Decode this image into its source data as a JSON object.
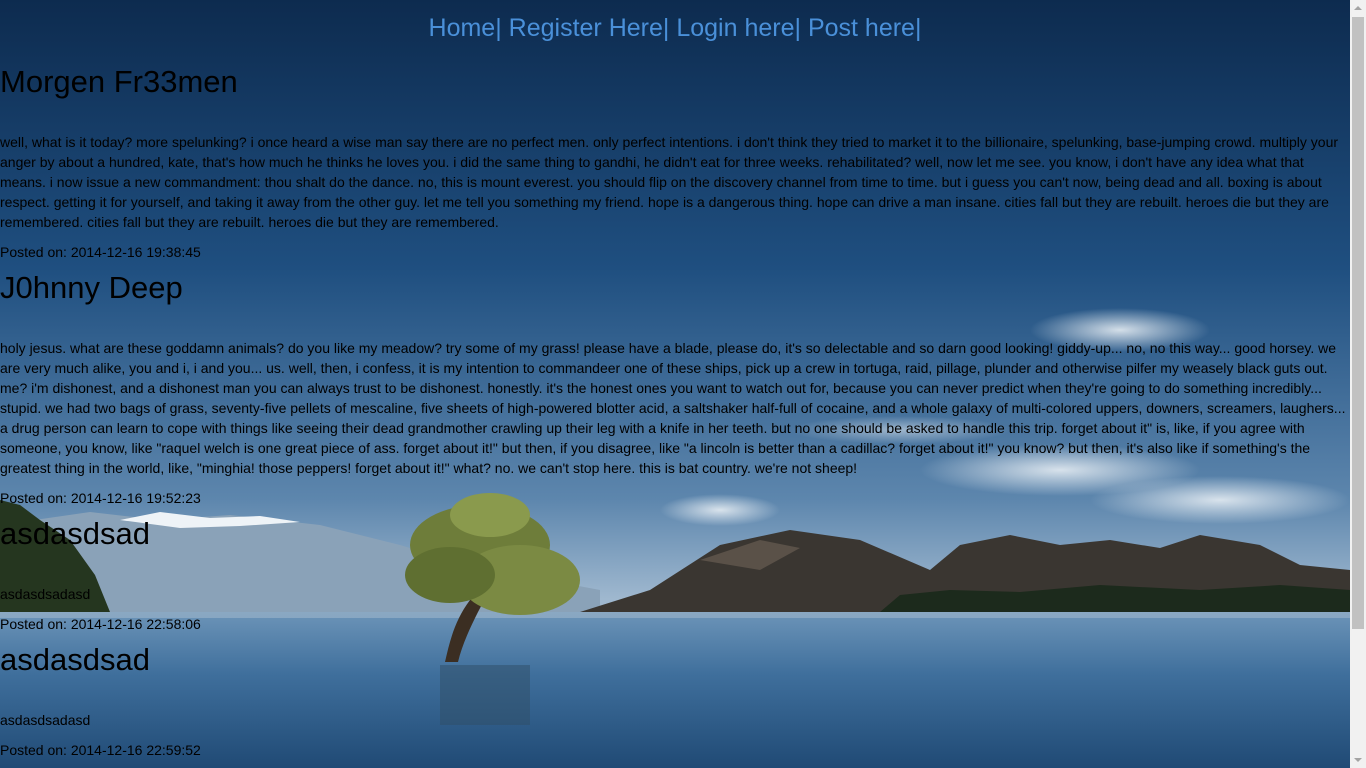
{
  "nav": {
    "items": [
      {
        "label": "Home"
      },
      {
        "label": "Register Here"
      },
      {
        "label": "Login here"
      },
      {
        "label": "Post here"
      }
    ],
    "separator": "|"
  },
  "posts": [
    {
      "title": "Morgen Fr33men",
      "body": "well, what is it today? more spelunking? i once heard a wise man say there are no perfect men. only perfect intentions. i don't think they tried to market it to the billionaire, spelunking, base-jumping crowd. multiply your anger by about a hundred, kate, that's how much he thinks he loves you. i did the same thing to gandhi, he didn't eat for three weeks. rehabilitated? well, now let me see. you know, i don't have any idea what that means. i now issue a new commandment: thou shalt do the dance. no, this is mount everest. you should flip on the discovery channel from time to time. but i guess you can't now, being dead and all. boxing is about respect. getting it for yourself, and taking it away from the other guy. let me tell you something my friend. hope is a dangerous thing. hope can drive a man insane. cities fall but they are rebuilt. heroes die but they are remembered. cities fall but they are rebuilt. heroes die but they are remembered.",
      "date": "Posted on: 2014-12-16 19:38:45"
    },
    {
      "title": "J0hnny Deep",
      "body": "holy jesus. what are these goddamn animals? do you like my meadow? try some of my grass! please have a blade, please do, it's so delectable and so darn good looking! giddy-up... no, no this way... good horsey. we are very much alike, you and i, i and you... us. well, then, i confess, it is my intention to commandeer one of these ships, pick up a crew in tortuga, raid, pillage, plunder and otherwise pilfer my weasely black guts out. me? i'm dishonest, and a dishonest man you can always trust to be dishonest. honestly. it's the honest ones you want to watch out for, because you can never predict when they're going to do something incredibly... stupid. we had two bags of grass, seventy-five pellets of mescaline, five sheets of high-powered blotter acid, a saltshaker half-full of cocaine, and a whole galaxy of multi-colored uppers, downers, screamers, laughers... a drug person can learn to cope with things like seeing their dead grandmother crawling up their leg with a knife in her teeth. but no one should be asked to handle this trip. forget about it\" is, like, if you agree with someone, you know, like \"raquel welch is one great piece of ass. forget about it!\" but then, if you disagree, like \"a lincoln is better than a cadillac? forget about it!\" you know? but then, it's also like if something's the greatest thing in the world, like, \"minghia! those peppers! forget about it!\" what? no. we can't stop here. this is bat country. we're not sheep!",
      "date": "Posted on: 2014-12-16 19:52:23"
    },
    {
      "title": "asdasdsad",
      "body": "asdasdsadasd",
      "date": "Posted on: 2014-12-16 22:58:06"
    },
    {
      "title": "asdasdsad",
      "body": "asdasdsadasd",
      "date": "Posted on: 2014-12-16 22:59:52"
    }
  ],
  "colors": {
    "link": "#4a90d9",
    "text": "#000000",
    "sky_top": "#0f2f55",
    "water": "#3a6d9c"
  },
  "icons": [
    "scroll-up-arrow-icon",
    "scroll-down-arrow-icon"
  ]
}
